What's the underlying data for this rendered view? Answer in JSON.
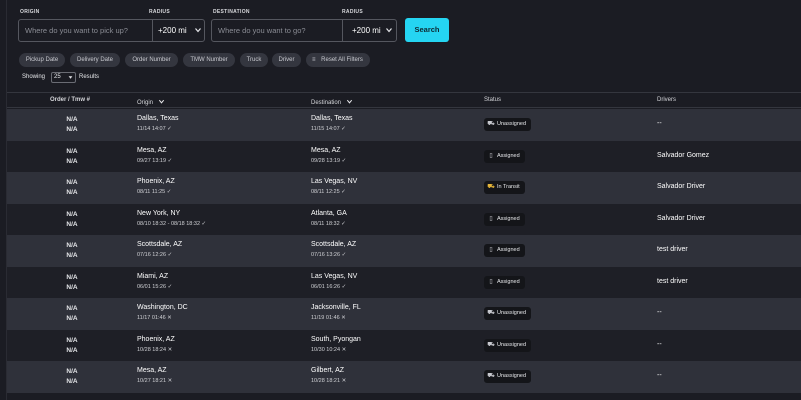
{
  "search": {
    "origin_label": "ORIGIN",
    "origin_placeholder": "Where do you want to pick up?",
    "origin_radius_label": "RADIUS",
    "origin_radius": "+200 mi",
    "destination_label": "DESTINATION",
    "destination_placeholder": "Where do you want to go?",
    "destination_radius_label": "RADIUS",
    "destination_radius": "+200 mi",
    "search_button": "Search"
  },
  "filters": [
    "Pickup Date",
    "Delivery Date",
    "Order Number",
    "TMW Number",
    "Truck",
    "Driver",
    "Reset All Filters"
  ],
  "showing": {
    "prefix": "Showing",
    "value": "25",
    "suffix": "Results"
  },
  "columns": {
    "order": "Order / Tmw #",
    "origin": "Origin",
    "destination": "Destination",
    "status": "Status",
    "drivers": "Drivers"
  },
  "rows": [
    {
      "order": "N/A",
      "tmw": "N/A",
      "origin": "Dallas, Texas",
      "origin_date": "11/14 14:07 ✓",
      "dest": "Dallas, Texas",
      "dest_date": "11/15 14:07 ✓",
      "status": "Unassigned",
      "status_icon": "truck-icon",
      "driver": "--"
    },
    {
      "order": "N/A",
      "tmw": "N/A",
      "origin": "Mesa, AZ",
      "origin_date": "09/27 13:19 ✓",
      "dest": "Mesa, AZ",
      "dest_date": "09/28 13:19 ✓",
      "status": "Assigned",
      "status_icon": "assigned-icon",
      "driver": "Salvador Gomez"
    },
    {
      "order": "N/A",
      "tmw": "N/A",
      "origin": "Phoenix, AZ",
      "origin_date": "08/11 11:25 ✓",
      "dest": "Las Vegas, NV",
      "dest_date": "08/11 12:25 ✓",
      "status": "In Transit",
      "status_icon": "in-transit-icon",
      "driver": "Salvador Driver"
    },
    {
      "order": "N/A",
      "tmw": "N/A",
      "origin": "New York, NY",
      "origin_date": "08/10 18:32 - 08/18 18:32 ✓",
      "dest": "Atlanta, GA",
      "dest_date": "08/11 18:32 ✓",
      "status": "Assigned",
      "status_icon": "assigned-icon",
      "driver": "Salvador Driver"
    },
    {
      "order": "N/A",
      "tmw": "N/A",
      "origin": "Scottsdale, AZ",
      "origin_date": "07/16 12:26 ✓",
      "dest": "Scottsdale, AZ",
      "dest_date": "07/16 13:26 ✓",
      "status": "Assigned",
      "status_icon": "assigned-icon",
      "driver": "test driver"
    },
    {
      "order": "N/A",
      "tmw": "N/A",
      "origin": "Miami, AZ",
      "origin_date": "06/01 15:26 ✓",
      "dest": "Las Vegas, NV",
      "dest_date": "06/01 16:26 ✓",
      "status": "Assigned",
      "status_icon": "assigned-icon",
      "driver": "test driver"
    },
    {
      "order": "N/A",
      "tmw": "N/A",
      "origin": "Washington, DC",
      "origin_date": "11/17 01:46 ✕",
      "dest": "Jacksonville, FL",
      "dest_date": "11/19 01:46 ✕",
      "status": "Unassigned",
      "status_icon": "truck-icon",
      "driver": "--"
    },
    {
      "order": "N/A",
      "tmw": "N/A",
      "origin": "Phoenix, AZ",
      "origin_date": "10/28 18:24 ✕",
      "dest": "South, Pyongan",
      "dest_date": "10/30 10:24 ✕",
      "status": "Unassigned",
      "status_icon": "truck-icon",
      "driver": "--"
    },
    {
      "order": "N/A",
      "tmw": "N/A",
      "origin": "Mesa, AZ",
      "origin_date": "10/27 18:21 ✕",
      "dest": "Gilbert, AZ",
      "dest_date": "10/28 18:21 ✕",
      "status": "Unassigned",
      "status_icon": "truck-icon",
      "driver": "--"
    }
  ],
  "colors": {
    "accent": "#25d5f2",
    "row_odd": "#2f313a",
    "row_even": "#1e1f26",
    "chip": "#34363f",
    "in_transit": "#e8b73a"
  }
}
